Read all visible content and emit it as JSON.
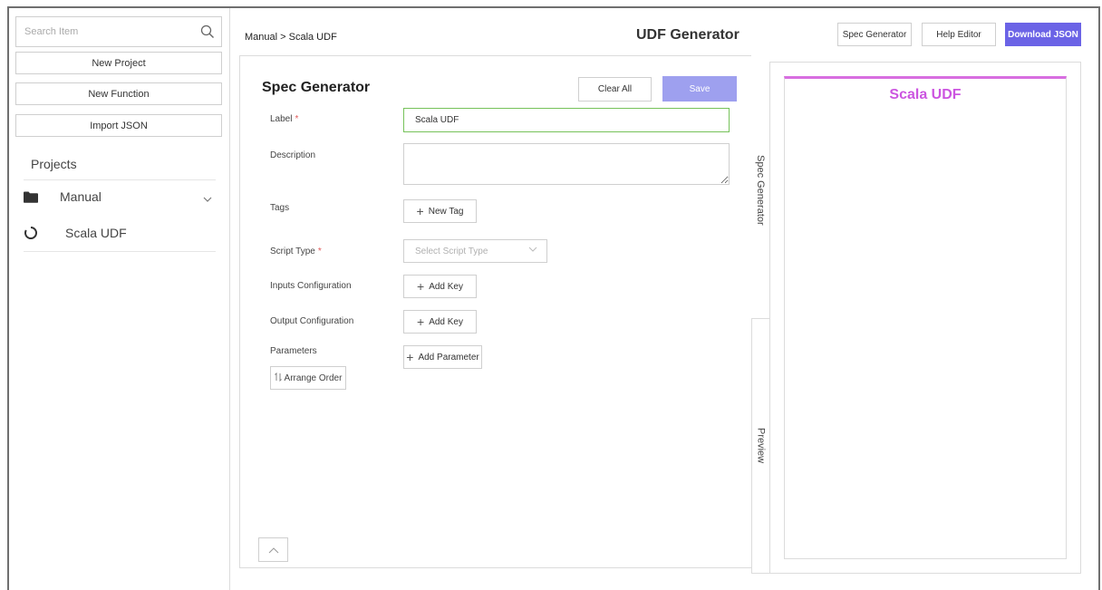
{
  "sidebar": {
    "search_placeholder": "Search Item",
    "new_project": "New Project",
    "new_function": "New Function",
    "import_json": "Import JSON",
    "projects_title": "Projects",
    "tree": [
      {
        "label": "Manual",
        "icon": "folder-icon"
      },
      {
        "label": "Scala UDF",
        "icon": "spinner-icon"
      }
    ]
  },
  "header": {
    "breadcrumb": "Manual > Scala UDF",
    "title": "UDF Generator",
    "spec_generator": "Spec Generator",
    "help_editor": "Help Editor",
    "download_json": "Download JSON"
  },
  "form": {
    "title": "Spec Generator",
    "clear_all": "Clear All",
    "save": "Save",
    "label_label": "Label",
    "label_value": "Scala UDF",
    "description_label": "Description",
    "tags_label": "Tags",
    "new_tag": "New Tag",
    "script_type_label": "Script Type",
    "script_type_placeholder": "Select Script Type",
    "inputs_label": "Inputs Configuration",
    "add_key": "Add Key",
    "output_label": "Output Configuration",
    "parameters_label": "Parameters",
    "add_parameter": "Add Parameter",
    "arrange_order": "Arrange Order",
    "required_mark": "*"
  },
  "tabs": {
    "spec_generator": "Spec Generator",
    "preview": "Preview"
  },
  "preview": {
    "title": "Scala UDF"
  },
  "colors": {
    "primary": "#6b63e6",
    "save": "#9ea0ef",
    "valid_border": "#76c25a",
    "preview_accent": "#d86ee0",
    "required": "#e05a5a"
  }
}
